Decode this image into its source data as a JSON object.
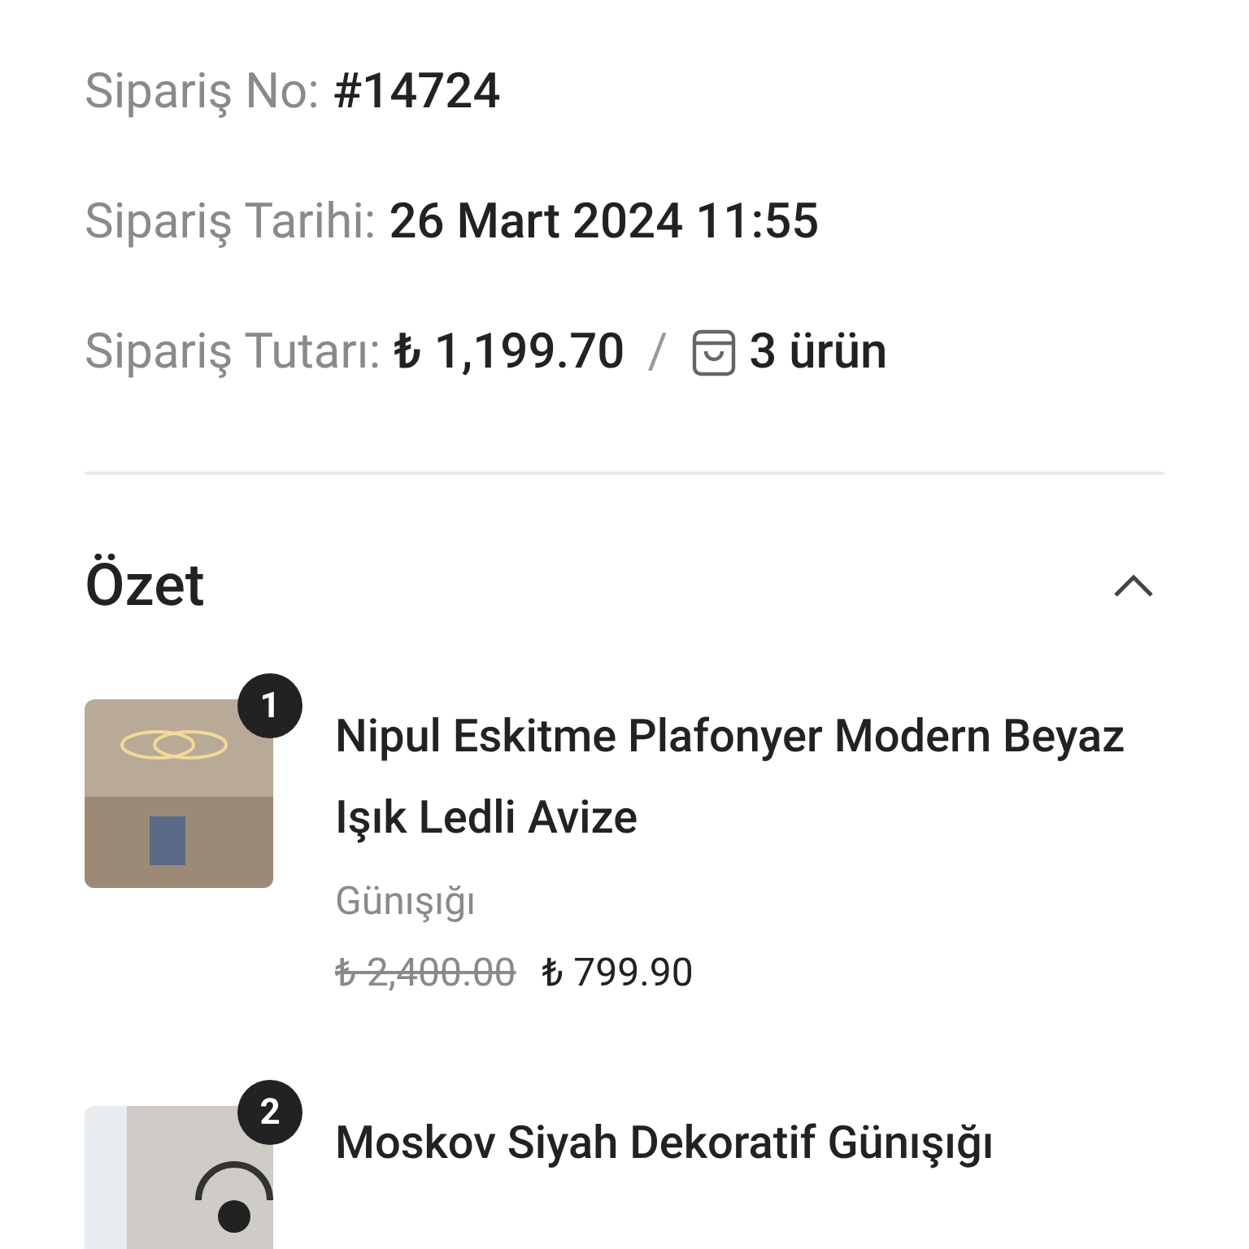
{
  "order_info": [
    {
      "label": "Sipariş No:",
      "value": "#14724"
    },
    {
      "label": "Sipariş Tarihi:",
      "value": "26 Mart 2024 11:55"
    },
    {
      "label": "Sipariş Tutarı:",
      "value": "₺ 1,199.70",
      "separator": "/",
      "count": "3 ürün"
    }
  ],
  "summary": {
    "title": "Özet",
    "expanded": true,
    "items": [
      {
        "badge": "1",
        "title": "Nipul Eskitme Plafonyer Modern Beyaz Işık Ledli Avize",
        "variant": "Günışığı",
        "old_price": "₺ 2,400.00",
        "price": "₺ 799.90"
      },
      {
        "badge": "2",
        "title": "Moskov Siyah Dekoratif Günışığı"
      }
    ]
  }
}
